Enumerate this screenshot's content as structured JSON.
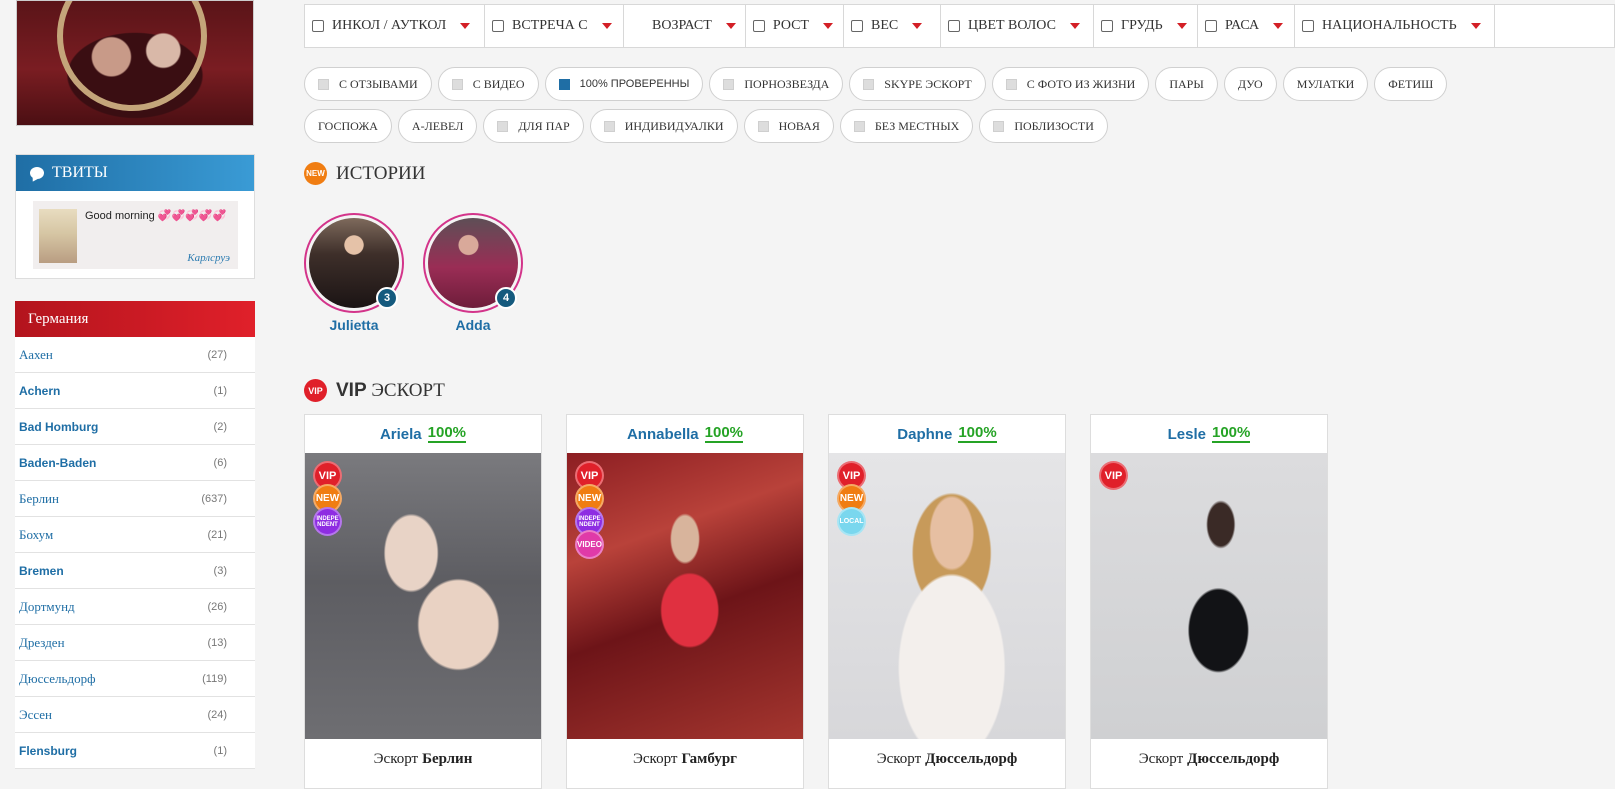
{
  "sidebar": {
    "tweets": {
      "title": "ТВИТЫ",
      "tweet_text": "Good morning 💞💞💞💞💞",
      "tweet_city": "Карлсруэ"
    },
    "region": {
      "title": "Германия",
      "cities": [
        {
          "name": "Аахен",
          "count": "(27)",
          "bold": false
        },
        {
          "name": "Achern",
          "count": "(1)",
          "bold": true
        },
        {
          "name": "Bad Homburg",
          "count": "(2)",
          "bold": true
        },
        {
          "name": "Baden-Baden",
          "count": "(6)",
          "bold": true
        },
        {
          "name": "Берлин",
          "count": "(637)",
          "bold": false
        },
        {
          "name": "Бохум",
          "count": "(21)",
          "bold": false
        },
        {
          "name": "Bremen",
          "count": "(3)",
          "bold": true
        },
        {
          "name": "Дортмунд",
          "count": "(26)",
          "bold": false
        },
        {
          "name": "Дрезден",
          "count": "(13)",
          "bold": false
        },
        {
          "name": "Дюссельдорф",
          "count": "(119)",
          "bold": false
        },
        {
          "name": "Эссен",
          "count": "(24)",
          "bold": false
        },
        {
          "name": "Flensburg",
          "count": "(1)",
          "bold": true
        }
      ]
    }
  },
  "filters": [
    "ИНКОЛ / АУТКОЛ",
    "ВСТРЕЧА С",
    "ВОЗРАСТ",
    "РОСТ",
    "ВЕС",
    "ЦВЕТ ВОЛОС",
    "ГРУДЬ",
    "РАСА",
    "НАЦИОНАЛЬНОСТЬ"
  ],
  "tags": {
    "row1": [
      {
        "label": "С ОТЗЫВАМИ",
        "checkbox": true,
        "checked": false
      },
      {
        "label": "С ВИДЕО",
        "checkbox": true,
        "checked": false
      },
      {
        "label": "100% ПРОВЕРЕННЫ",
        "checkbox": true,
        "checked": true
      },
      {
        "label": "ПОРНОЗВЕЗДА",
        "checkbox": true,
        "checked": false
      },
      {
        "label": "SKYPE ЭСКОРТ",
        "checkbox": true,
        "checked": false
      },
      {
        "label": "С ФОТО ИЗ ЖИЗНИ",
        "checkbox": true,
        "checked": false
      },
      {
        "label": "ПАРЫ",
        "checkbox": false,
        "checked": false
      },
      {
        "label": "ДУО",
        "checkbox": false,
        "checked": false
      },
      {
        "label": "МУЛАТКИ",
        "checkbox": false,
        "checked": false
      },
      {
        "label": "ФЕТИШ",
        "checkbox": false,
        "checked": false
      }
    ],
    "row2": [
      {
        "label": "ГОСПОЖА",
        "checkbox": false,
        "checked": false
      },
      {
        "label": "А-ЛЕВЕЛ",
        "checkbox": false,
        "checked": false
      },
      {
        "label": "ДЛЯ ПАР",
        "checkbox": true,
        "checked": false
      },
      {
        "label": "ИНДИВИДУАЛКИ",
        "checkbox": true,
        "checked": false
      },
      {
        "label": "НОВАЯ",
        "checkbox": true,
        "checked": false
      },
      {
        "label": "БЕЗ МЕСТНЫХ",
        "checkbox": true,
        "checked": false
      },
      {
        "label": "ПОБЛИЗОСТИ",
        "checkbox": true,
        "checked": false
      }
    ]
  },
  "stories": {
    "badge": "NEW",
    "title": "ИСТОРИИ",
    "items": [
      {
        "name": "Julietta",
        "count": "3"
      },
      {
        "name": "Adda",
        "count": "4"
      }
    ]
  },
  "vip": {
    "badge": "VIP",
    "title_bold": "VIP",
    "title_rest": "ЭСКОРТ",
    "cards": [
      {
        "name": "Ariela",
        "verified": "100%",
        "city_prefix": "Эскорт",
        "city": "Берлин",
        "badges": [
          "VIP",
          "NEW",
          "INDEPE NDENT"
        ]
      },
      {
        "name": "Annabella",
        "verified": "100%",
        "city_prefix": "Эскорт",
        "city": "Гамбург",
        "badges": [
          "VIP",
          "NEW",
          "INDEPE NDENT",
          "VIDEO"
        ]
      },
      {
        "name": "Daphne",
        "verified": "100%",
        "city_prefix": "Эскорт",
        "city": "Дюссельдорф",
        "badges": [
          "VIP",
          "NEW",
          "LOCAL"
        ]
      },
      {
        "name": "Lesle",
        "verified": "100%",
        "city_prefix": "Эскорт",
        "city": "Дюссельдорф",
        "badges": [
          "VIP"
        ]
      }
    ]
  },
  "colors": {
    "accent_blue": "#1f6ea5",
    "accent_red": "#e0202a",
    "verified_green": "#25a325",
    "story_ring": "#d3348a"
  }
}
